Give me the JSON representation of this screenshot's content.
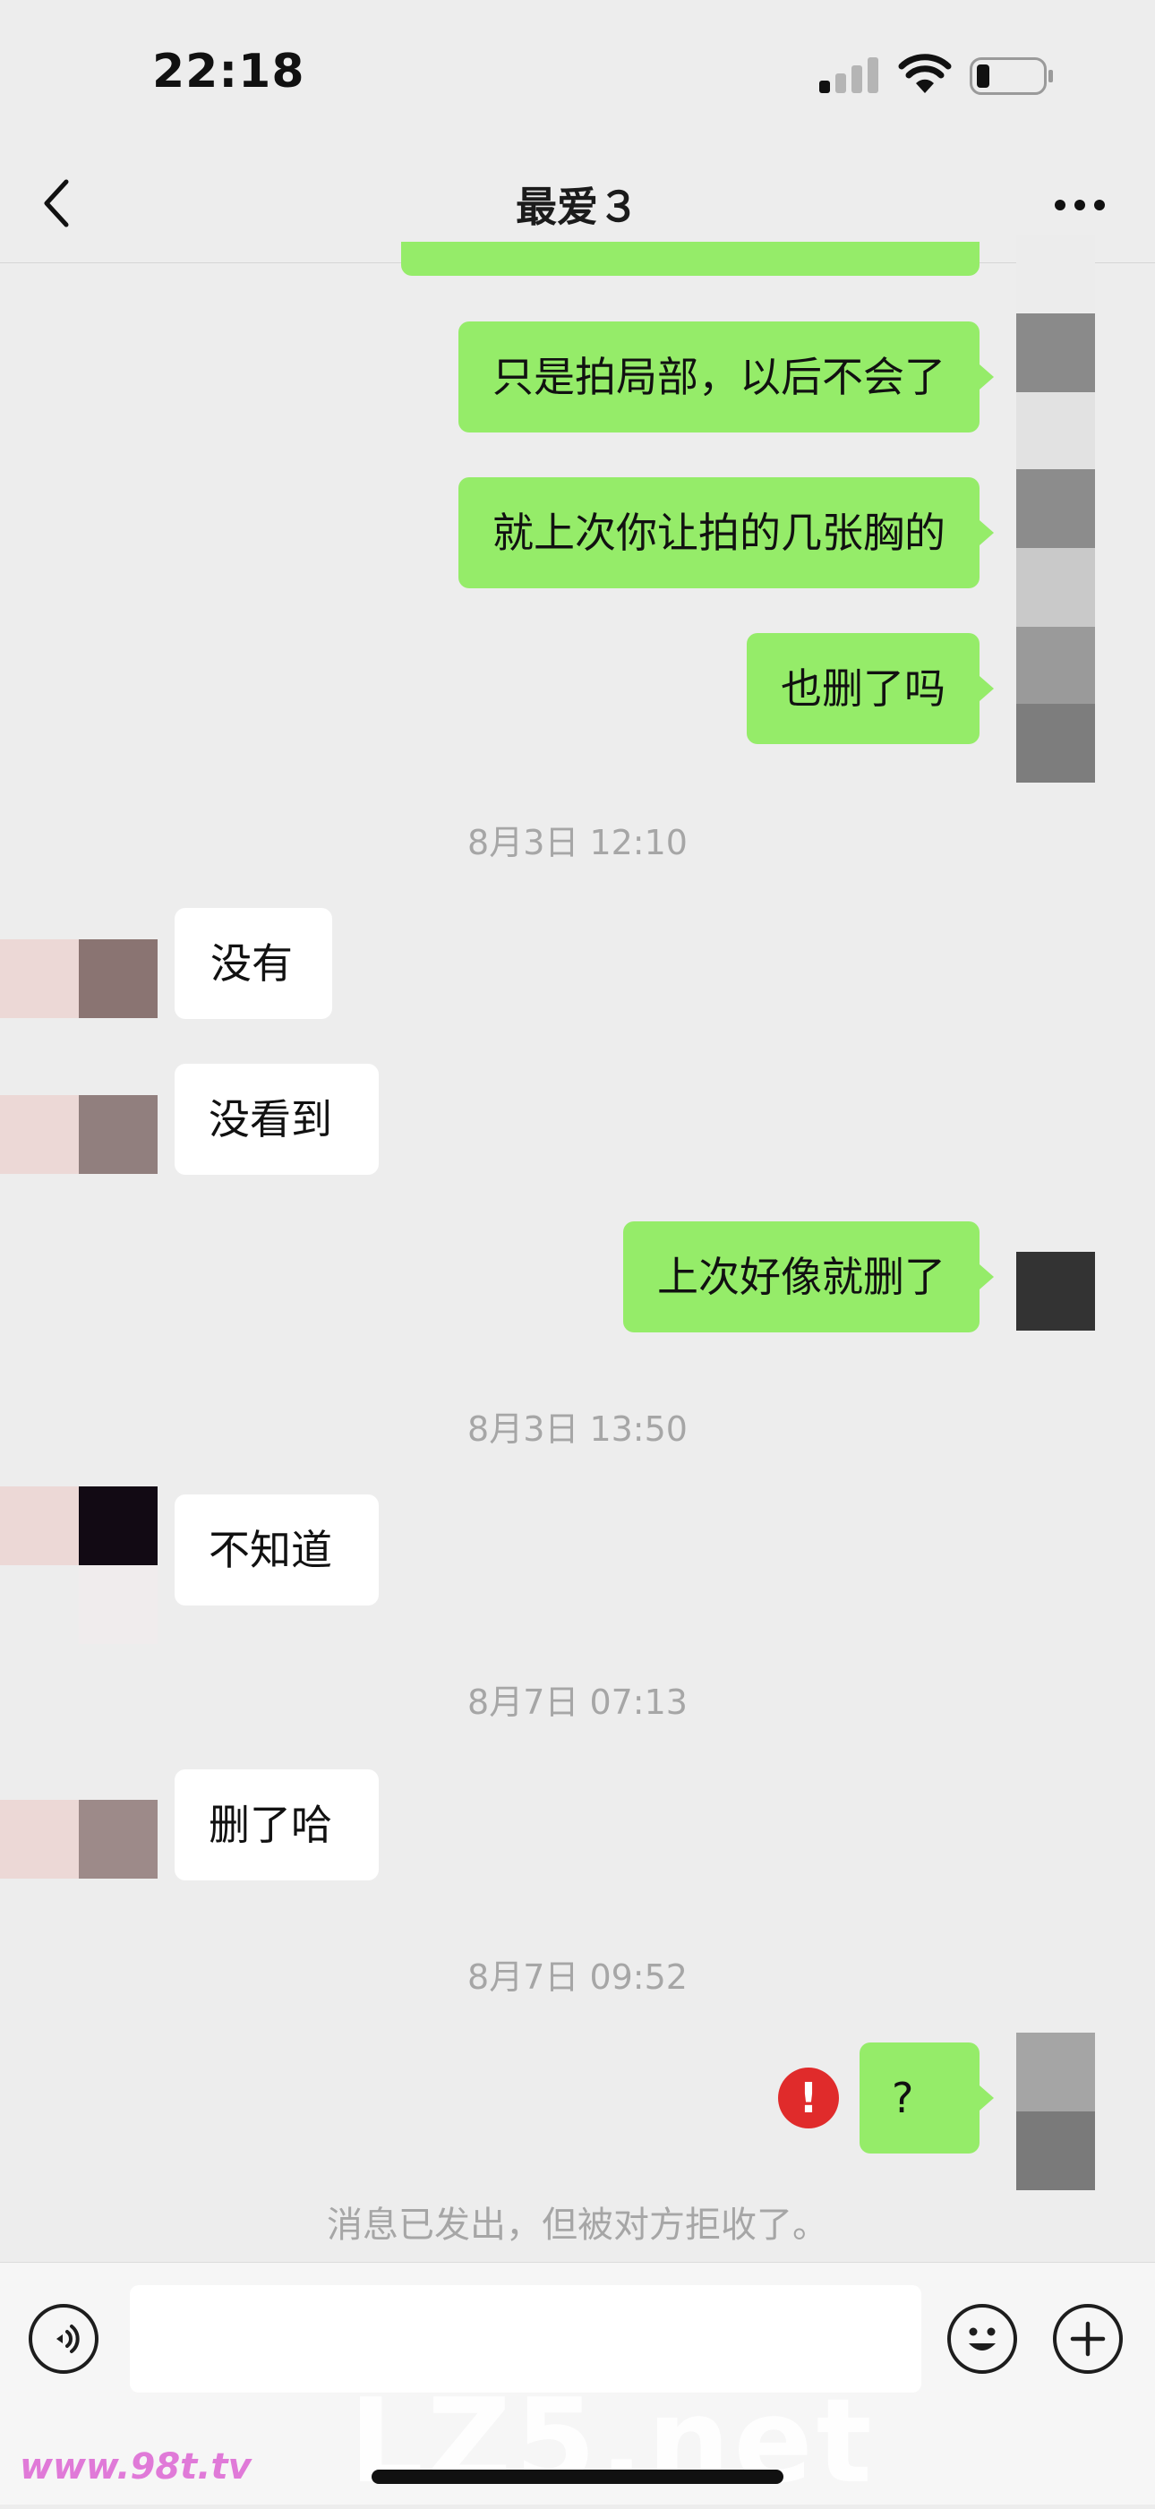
{
  "status_bar": {
    "time": "22:18"
  },
  "nav": {
    "title": "最爱３"
  },
  "messages": [
    {
      "side": "me",
      "text": "只是拍局部，以后不会了"
    },
    {
      "side": "me",
      "text": "就上次你让拍的几张胸的"
    },
    {
      "side": "me",
      "text": "也删了吗"
    },
    {
      "timestamp": "8月3日 12:10"
    },
    {
      "side": "them",
      "text": "没有"
    },
    {
      "side": "them",
      "text": "没看到"
    },
    {
      "side": "me",
      "text": "上次好像就删了"
    },
    {
      "timestamp": "8月3日 13:50"
    },
    {
      "side": "them",
      "text": "不知道"
    },
    {
      "timestamp": "8月7日 07:13"
    },
    {
      "side": "them",
      "text": "删了哈"
    },
    {
      "timestamp": "8月7日 09:52"
    },
    {
      "side": "me",
      "text": "?"
    }
  ],
  "rejection_notice": "消息已发出，但被对方拒收了。",
  "input": {
    "placeholder": ""
  },
  "icons": {
    "back": "chevron-left-icon",
    "more": "more-dots-icon",
    "voice": "voice-icon",
    "emoji": "emoji-icon",
    "plus": "plus-icon",
    "error": "error-icon"
  },
  "watermark": {
    "text": "LZ5.net",
    "site": "www.98t.tv"
  },
  "colors": {
    "sent_bubble": "#95ec69",
    "received_bubble": "#ffffff",
    "background": "#ededed",
    "error": "#e02b2b"
  }
}
